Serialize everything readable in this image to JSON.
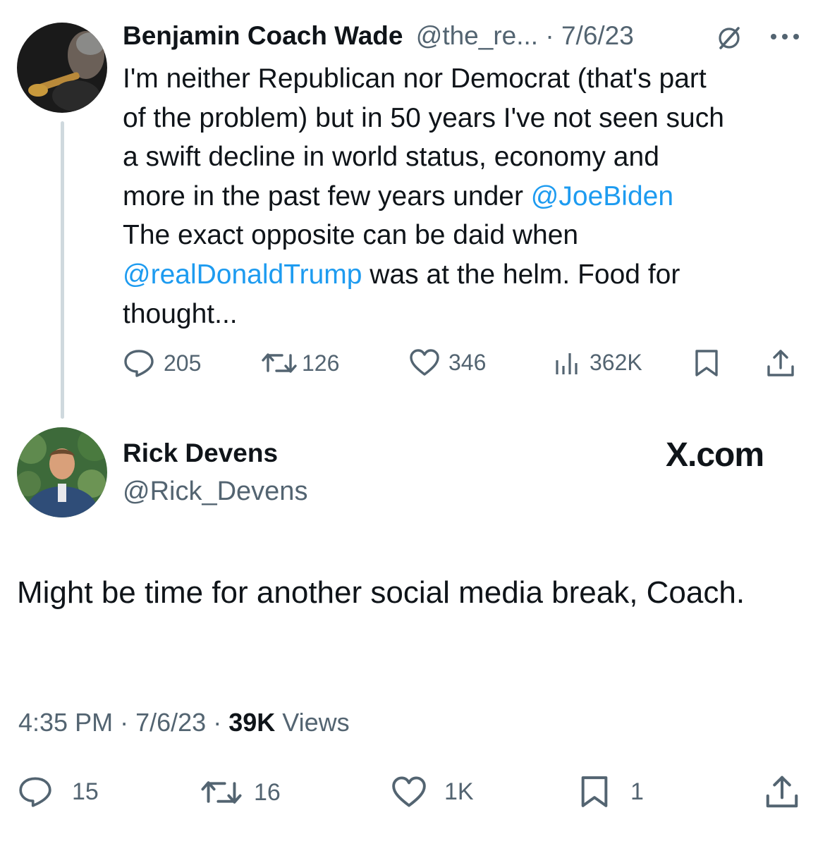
{
  "parent_tweet": {
    "author_name": "Benjamin Coach Wade",
    "handle": "@the_re...",
    "separator": "·",
    "date": "7/6/23",
    "text_lines": [
      "I'm neither Republican nor Democrat (that's part",
      "of the problem) but in 50 years I've not seen such",
      "a swift decline in world status, economy and"
    ],
    "line4_prefix": "more in the past few years under ",
    "mention1": "@JoeBiden",
    "line5": "The exact opposite can be daid when",
    "mention2": "@realDonaldTrump",
    "line6_suffix": " was at the helm. Food for",
    "line7": "thought...",
    "metrics": {
      "replies": "205",
      "reposts": "126",
      "likes": "346",
      "views": "362K"
    },
    "icons": [
      "grok-icon",
      "more-icon",
      "reply-icon",
      "repost-icon",
      "like-icon",
      "views-icon",
      "bookmark-icon",
      "share-icon"
    ]
  },
  "reply_tweet": {
    "author_name": "Rick Devens",
    "handle": "@Rick_Devens",
    "watermark": "X.com",
    "text": "Might be time for another social media break, Coach.",
    "time": "4:35 PM",
    "dot": "·",
    "date": "7/6/23",
    "views_count": "39K",
    "views_label": "Views",
    "metrics": {
      "replies": "15",
      "reposts": "16",
      "likes": "1K",
      "bookmarks": "1"
    }
  },
  "colors": {
    "text": "#0f1419",
    "secondary": "#536471",
    "link": "#1d9bf0",
    "thread_line": "#cfd9de"
  }
}
